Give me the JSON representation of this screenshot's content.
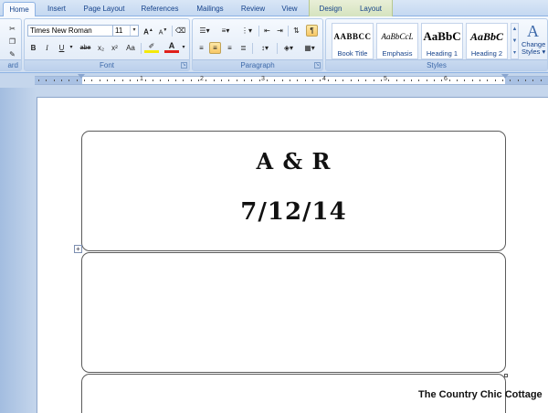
{
  "tabs": [
    {
      "label": "Home",
      "active": true
    },
    {
      "label": "Insert"
    },
    {
      "label": "Page Layout"
    },
    {
      "label": "References"
    },
    {
      "label": "Mailings"
    },
    {
      "label": "Review"
    },
    {
      "label": "View"
    },
    {
      "label": "Design"
    },
    {
      "label": "Layout"
    }
  ],
  "clipboard": {
    "label_fragment": "ard"
  },
  "font": {
    "name": "Times New Roman",
    "size": "11",
    "group_label": "Font",
    "buttons": {
      "bold": "B",
      "italic": "I",
      "underline": "U",
      "strike": "abe",
      "subscript": "x₂",
      "superscript": "x²",
      "change_case": "Aa",
      "grow": "A",
      "shrink": "A",
      "font_color": "A"
    }
  },
  "paragraph": {
    "group_label": "Paragraph",
    "pilcrow": "¶"
  },
  "styles": {
    "group_label": "Styles",
    "items": [
      {
        "sample": "AABBCC",
        "name": "Book Title"
      },
      {
        "sample": "AaBbCcL",
        "name": "Emphasis"
      },
      {
        "sample": "AaBbC",
        "name": "Heading 1"
      },
      {
        "sample": "AaBbC",
        "name": "Heading 2"
      }
    ],
    "change_styles_line1": "Change",
    "change_styles_line2": "Styles"
  },
  "ruler": {
    "numbers": [
      "1",
      "2",
      "3",
      "4",
      "5",
      "6"
    ]
  },
  "document": {
    "labels": [
      {
        "line1": "A & R",
        "line2": "7/12/14"
      },
      {
        "line1": "",
        "line2": ""
      },
      {
        "line1": "",
        "line2": ""
      }
    ]
  },
  "watermark": "The Country Chic Cottage",
  "colors": {
    "accent": "#15428b",
    "font_color_bar": "#e0201b",
    "highlight_bar": "#f4e90a"
  }
}
